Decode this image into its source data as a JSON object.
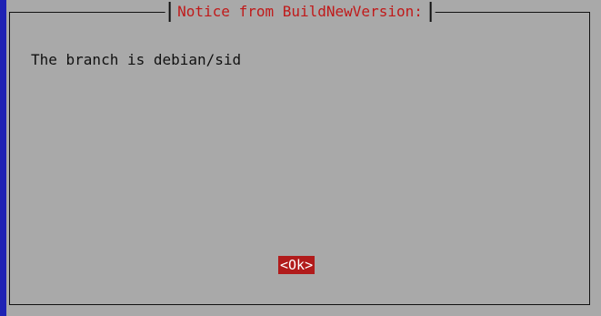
{
  "dialog": {
    "title": "Notice from BuildNewVersion:",
    "message": "The branch is debian/sid",
    "ok_label": "<Ok>"
  },
  "colors": {
    "background": "#a9a9a9",
    "title_text": "#c01a1a",
    "button_bg": "#b11b1b",
    "desktop": "#1e22b4"
  }
}
